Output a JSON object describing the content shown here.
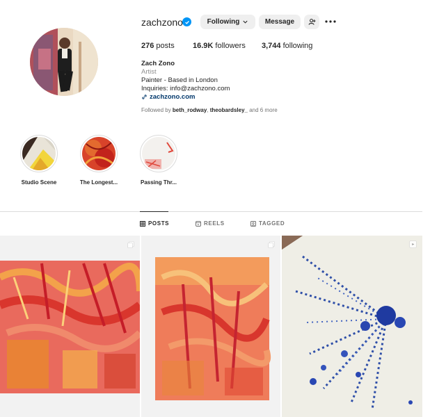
{
  "profile": {
    "username": "zachzono",
    "following_label": "Following",
    "message_label": "Message",
    "name": "Zach Zono",
    "category": "Artist",
    "bio_lines": [
      "Painter - Based in London",
      "Inquiries: info@zachzono.com"
    ],
    "link": "zachzono.com",
    "followed_by_prefix": "Followed by ",
    "followed_by_1": "beth_rodway",
    "followed_by_sep": ", ",
    "followed_by_2": "theobardsley_",
    "followed_by_suffix": " and 6 more"
  },
  "stats": {
    "posts_count": "276",
    "posts_label": " posts",
    "followers_count": "16.9K",
    "followers_label": " followers",
    "following_count": "3,744",
    "following_label": " following"
  },
  "highlights": [
    {
      "label": "Studio Scene"
    },
    {
      "label": "The Longest..."
    },
    {
      "label": "Passing Thr..."
    }
  ],
  "tabs": {
    "posts": "POSTS",
    "reels": "REELS",
    "tagged": "TAGGED",
    "active": "posts"
  },
  "colors": {
    "verified": "#0095f6",
    "link": "#00376b",
    "button_bg": "#efefef",
    "muted": "#8e8e8e"
  },
  "icons": [
    "verified-badge-icon",
    "chevron-down-icon",
    "add-user-icon",
    "more-options-icon",
    "link-icon",
    "grid-icon",
    "reels-icon",
    "tagged-icon",
    "multiple-posts-icon",
    "reel-icon"
  ]
}
